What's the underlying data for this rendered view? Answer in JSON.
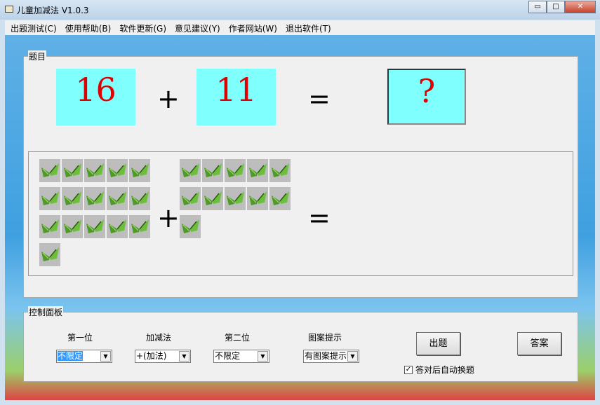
{
  "window": {
    "title": "儿童加减法 V1.0.3",
    "minimize": "▭",
    "maximize": "□",
    "close": "✕"
  },
  "menu": [
    "出题测试(C)",
    "使用帮助(B)",
    "软件更新(G)",
    "意见建议(Y)",
    "作者网站(W)",
    "退出软件(T)"
  ],
  "question": {
    "legend": "题目",
    "first": "16",
    "operator": "+",
    "second": "11",
    "equals": "=",
    "answer": "?",
    "first_count": 16,
    "second_count": 11
  },
  "control": {
    "legend": "控制面板",
    "first_label": "第一位",
    "first_value": "不限定",
    "op_label": "加减法",
    "op_value": "+(加法)",
    "second_label": "第二位",
    "second_value": "不限定",
    "hint_label": "图案提示",
    "hint_value": "有图案提示",
    "generate_button": "出题",
    "answer_button": "答案",
    "auto_next_label": "答对后自动换题",
    "auto_next_checked": true
  },
  "colors": {
    "number_bg": "#80ffff",
    "number_fg": "#e00000"
  }
}
